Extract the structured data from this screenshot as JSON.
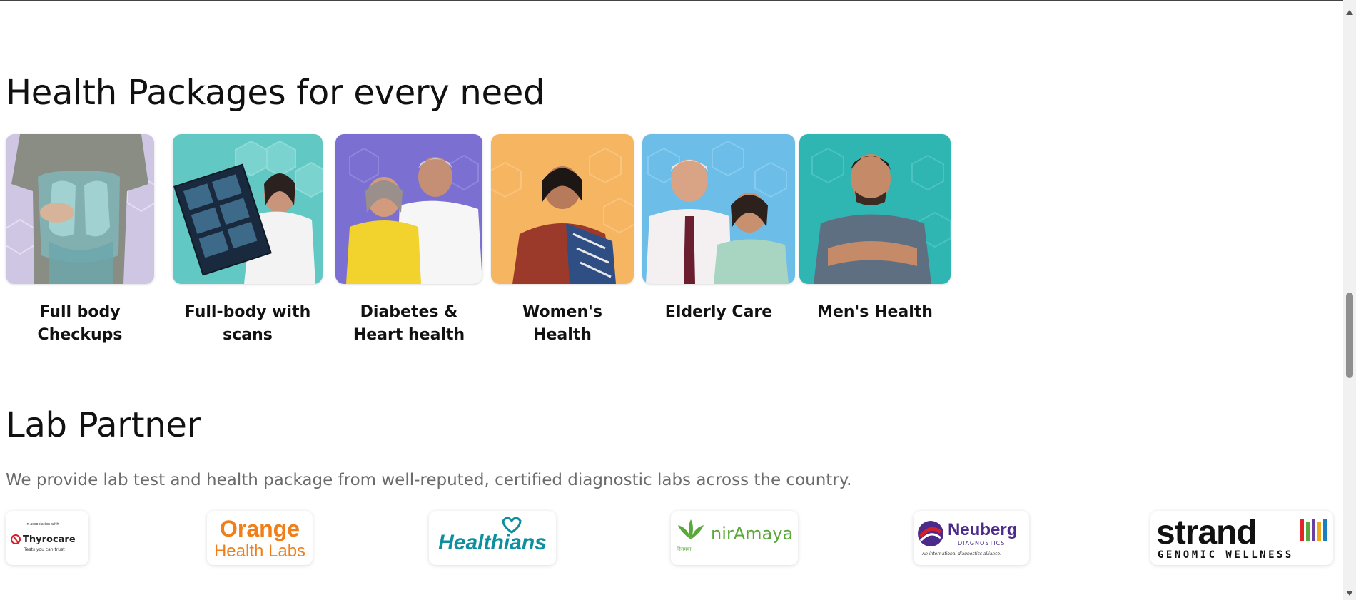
{
  "packages_section": {
    "title": "Health Packages for every need",
    "items": [
      {
        "label": "Full body Checkups",
        "icon": "torso-lungs-illustration",
        "bg": "#c9bfe0"
      },
      {
        "label": "Full-body with scans",
        "icon": "doctor-with-xray",
        "bg": "#5fc9c5"
      },
      {
        "label": "Diabetes & Heart health",
        "icon": "senior-couple",
        "bg": "#7a6fd1"
      },
      {
        "label": "Women's Health",
        "icon": "woman-in-saree",
        "bg": "#f6b45a"
      },
      {
        "label": "Elderly Care",
        "icon": "elderly-couple",
        "bg": "#6cbde8"
      },
      {
        "label": "Men's Health",
        "icon": "young-man-arms-crossed",
        "bg": "#2fb7b4"
      }
    ]
  },
  "lab_section": {
    "title": "Lab Partner",
    "subtitle": "We provide lab test and health package from well-reputed, certified diagnostic labs across the country.",
    "partners": [
      {
        "name": "Thyrocare",
        "tagline": "Tests you can trust",
        "kicker": "In association with"
      },
      {
        "name_line1": "Orange",
        "name_line2": "Health Labs"
      },
      {
        "name": "Healthians"
      },
      {
        "name": "nirAmaya",
        "script_line": "निरामया"
      },
      {
        "name": "Neuberg",
        "line2": "DIAGNOSTICS",
        "tagline": "An international diagnostics alliance."
      },
      {
        "name": "strand",
        "tagline": "GENOMIC WELLNESS"
      }
    ]
  },
  "colors": {
    "heading": "#111111",
    "subtitle": "#6b6b6b",
    "orange": "#f07f1a",
    "healthians_teal": "#0e8fa0",
    "niramaya_green": "#5aa83a",
    "neuberg_purple": "#4b2a8a",
    "thyrocare_red": "#d3202b"
  }
}
